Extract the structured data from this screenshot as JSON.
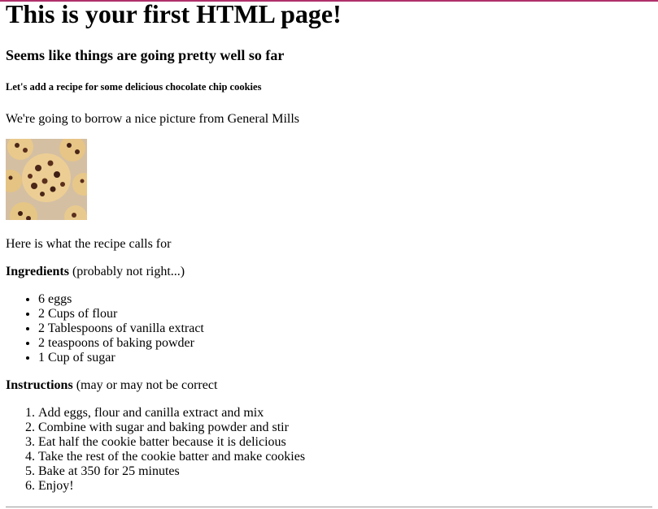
{
  "heading_main": "This is your first HTML page!",
  "heading_sub": "Seems like things are going pretty well so far",
  "heading_small": "Let's add a recipe for some delicious chocolate chip cookies",
  "borrow_text": "We're going to borrow a nice picture from General Mills",
  "recipe_intro": "Here is what the recipe calls for",
  "ingredients": {
    "label": "Ingredients",
    "note": " (probably not right...)",
    "items": [
      "6 eggs",
      "2 Cups of flour",
      "2 Tablespoons of vanilla extract",
      "2 teaspoons of baking powder",
      "1 Cup of sugar"
    ]
  },
  "instructions": {
    "label": "Instructions",
    "note": " (may or may not be correct",
    "steps": [
      "Add eggs, flour and canilla extract and mix",
      "Combine with sugar and baking powder and stir",
      "Eat half the cookie batter because it is delicious",
      "Take the rest of the cookie batter and make cookies",
      "Bake at 350 for 25 minutes",
      "Enjoy!"
    ]
  },
  "colors": {
    "top_border": "#b0306a",
    "rule": "#9a9a9a"
  },
  "image_subject": "chocolate-chip-cookies-photo"
}
